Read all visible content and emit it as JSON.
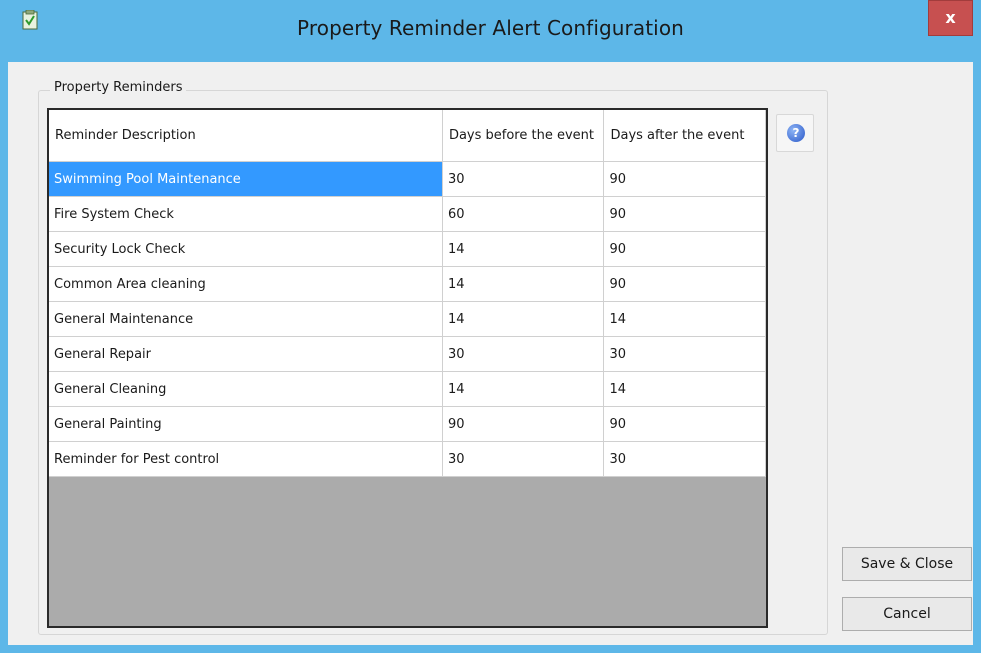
{
  "window": {
    "title": "Property Reminder Alert Configuration",
    "close_label": "x"
  },
  "group": {
    "label": "Property Reminders"
  },
  "grid": {
    "headers": [
      "Reminder Description",
      "Days before the event",
      "Days after the event"
    ],
    "rows": [
      {
        "description": "Swimming Pool Maintenance",
        "before": "30",
        "after": "90"
      },
      {
        "description": "Fire System Check",
        "before": "60",
        "after": "90"
      },
      {
        "description": "Security Lock Check",
        "before": "14",
        "after": "90"
      },
      {
        "description": "Common Area cleaning",
        "before": "14",
        "after": "90"
      },
      {
        "description": "General Maintenance",
        "before": "14",
        "after": "14"
      },
      {
        "description": "General Repair",
        "before": "30",
        "after": "30"
      },
      {
        "description": "General Cleaning",
        "before": "14",
        "after": "14"
      },
      {
        "description": "General Painting",
        "before": "90",
        "after": "90"
      },
      {
        "description": "Reminder for Pest control",
        "before": "30",
        "after": "30"
      }
    ],
    "selected_row": 0
  },
  "help": {
    "icon": "help-icon",
    "glyph": "?"
  },
  "buttons": {
    "save": "Save & Close",
    "cancel": "Cancel"
  },
  "colors": {
    "titlebar": "#5db7e8",
    "close": "#c75050",
    "selection": "#3399ff",
    "grid_empty": "#ababab"
  }
}
